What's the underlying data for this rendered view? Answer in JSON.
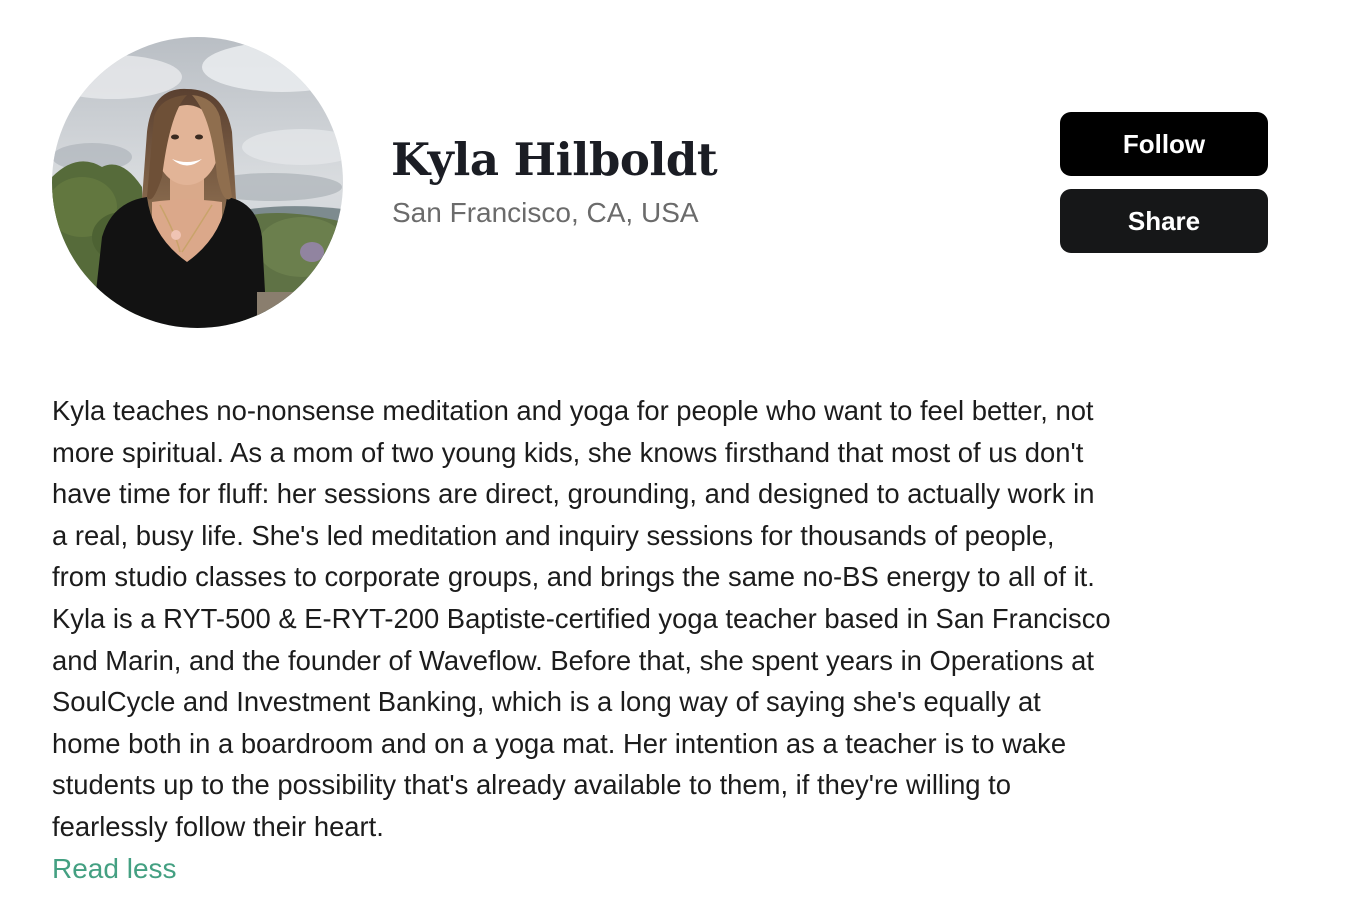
{
  "profile": {
    "name": "Kyla Hilboldt",
    "location": "San Francisco, CA, USA",
    "avatar_icon": "profile-photo"
  },
  "actions": {
    "follow_label": "Follow",
    "share_label": "Share"
  },
  "bio": {
    "lines": [
      "Kyla teaches no-nonsense meditation and yoga for people who want to feel better, not",
      "more spiritual. As a mom of two young kids, she knows firsthand that most of us don't",
      "have time for fluff: her sessions are direct, grounding, and designed to actually work in",
      "a real, busy life. She's led meditation and inquiry sessions for thousands of people,",
      "from studio classes to corporate groups, and brings the same no-BS energy to all of it.",
      "Kyla is a RYT-500 & E-RYT-200 Baptiste-certified yoga teacher based in San Francisco",
      "and Marin, and the founder of Waveflow. Before that, she spent years in Operations at",
      "SoulCycle and Investment Banking, which is a long way of saying she's equally at",
      "home both in a boardroom and on a yoga mat. Her intention as a teacher is to wake",
      "students up to the possibility that's already available to them, if they're willing to",
      "fearlessly follow their heart."
    ],
    "toggle_label": "Read less"
  },
  "colors": {
    "link": "#44a082",
    "button_primary": "#000000",
    "button_secondary": "#161718",
    "name_text": "#1b1d24",
    "muted_text": "#6b6b6b"
  }
}
